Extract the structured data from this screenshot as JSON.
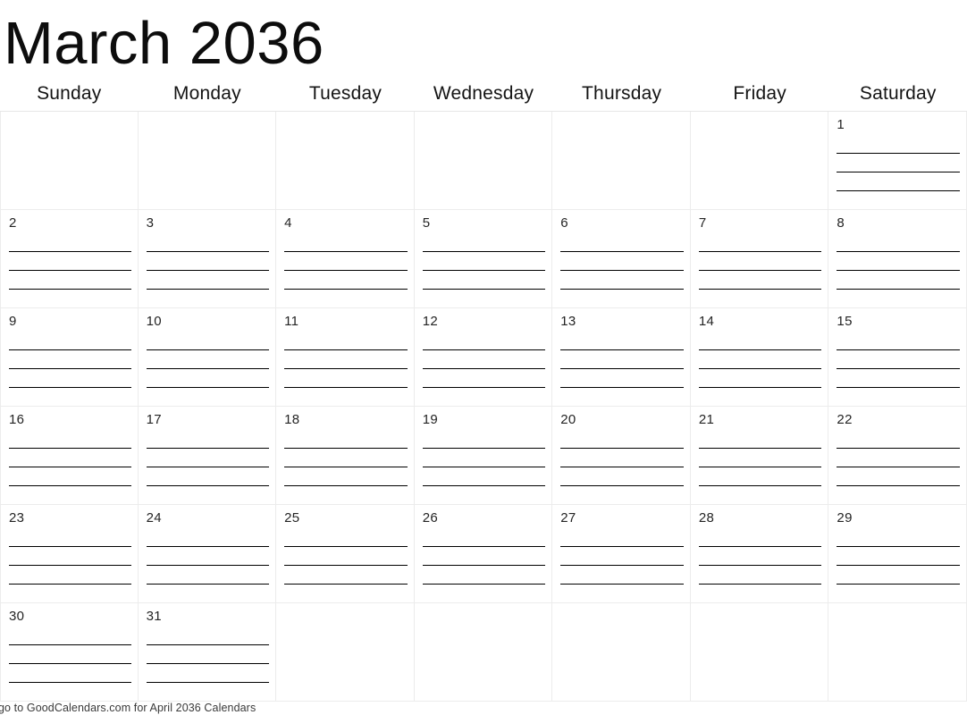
{
  "calendar": {
    "title": "March 2036",
    "month": "March",
    "year": "2036",
    "weekday_headers": [
      "Sunday",
      "Monday",
      "Tuesday",
      "Wednesday",
      "Thursday",
      "Friday",
      "Saturday"
    ],
    "weeks": [
      [
        "",
        "",
        "",
        "",
        "",
        "",
        "1"
      ],
      [
        "2",
        "3",
        "4",
        "5",
        "6",
        "7",
        "8"
      ],
      [
        "9",
        "10",
        "11",
        "12",
        "13",
        "14",
        "15"
      ],
      [
        "16",
        "17",
        "18",
        "19",
        "20",
        "21",
        "22"
      ],
      [
        "23",
        "24",
        "25",
        "26",
        "27",
        "28",
        "29"
      ],
      [
        "30",
        "31",
        "",
        "",
        "",
        "",
        ""
      ]
    ],
    "writing_lines_per_cell": 4,
    "colors": {
      "page_background": "#ffffff",
      "cell_background": "#ffffff",
      "grid_border": "#ececec",
      "writing_line": "#000000",
      "text": "#1a1a1a",
      "title_text": "#0d0d0d",
      "footer_text": "#3a3a3a"
    }
  },
  "footer": {
    "text": "go to GoodCalendars.com for April 2036 Calendars"
  }
}
